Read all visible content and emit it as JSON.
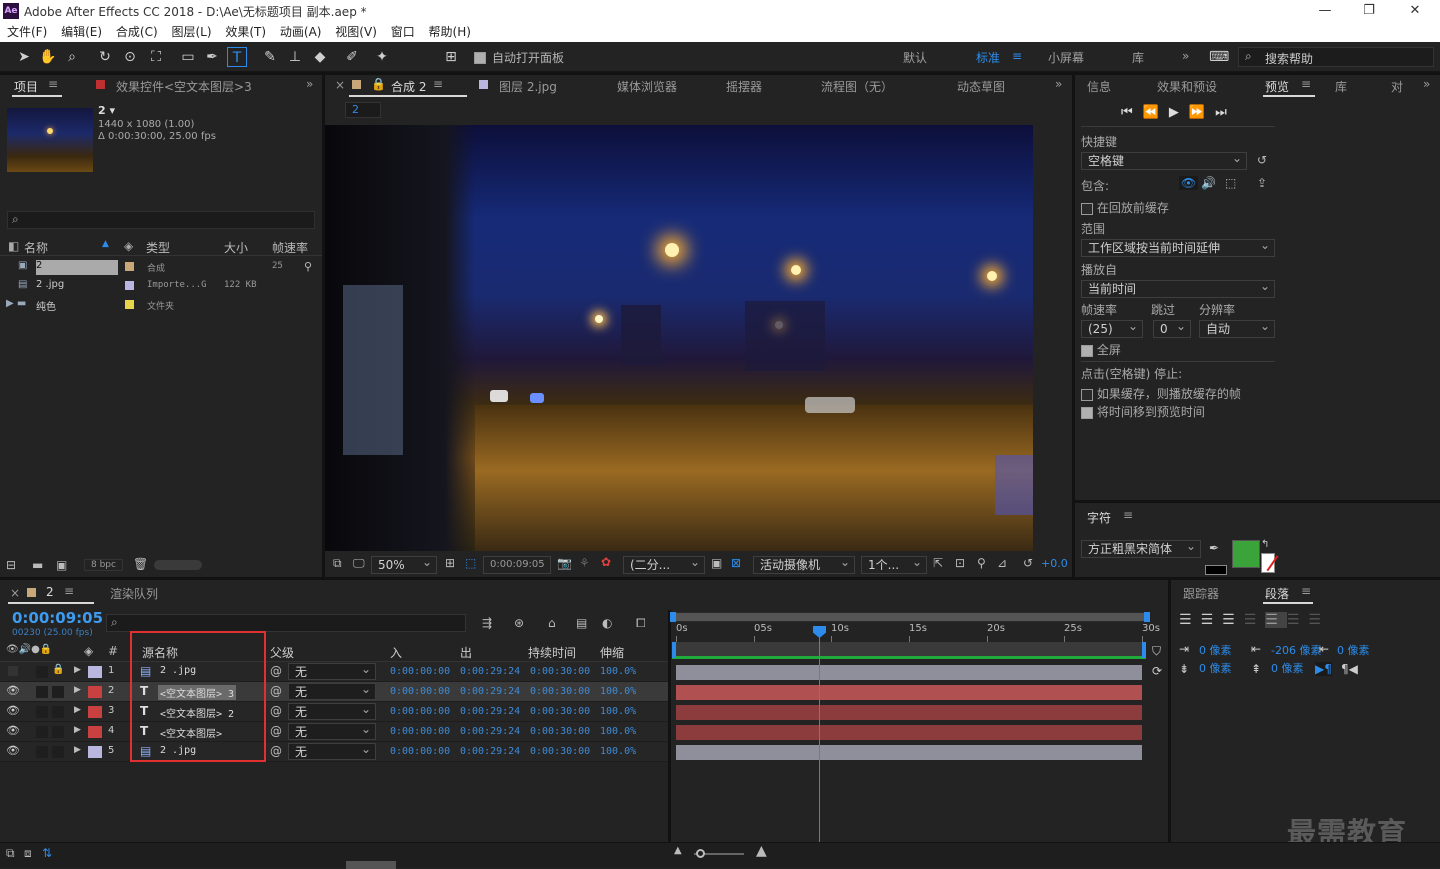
{
  "app": {
    "icon_text": "Ae",
    "title": "Adobe After Effects CC 2018 - D:\\Ae\\无标题项目 副本.aep *",
    "controls": [
      "—",
      "❐",
      "✕"
    ]
  },
  "menu": [
    "文件(F)",
    "编辑(E)",
    "合成(C)",
    "图层(L)",
    "效果(T)",
    "动画(A)",
    "视图(V)",
    "窗口",
    "帮助(H)"
  ],
  "toolbar": {
    "auto_open_label": "自动打开面板",
    "workspaces": [
      "默认",
      "标准",
      "小屏幕",
      "库"
    ],
    "active_workspace": "标准",
    "search_help": "搜索帮助"
  },
  "project": {
    "tab_project": "项目",
    "tab_effects": "效果控件<空文本图层>3",
    "comp_name": "2 ▾",
    "comp_dims": "1440 x 1080 (1.00)",
    "comp_dur": "Δ 0:00:30:00, 25.00 fps",
    "columns": [
      "名称",
      "类型",
      "大小",
      "帧速率"
    ],
    "items": [
      {
        "name": "2",
        "type": "合成",
        "size": "",
        "fps": "25",
        "color": "#c8a878"
      },
      {
        "name": "2 .jpg",
        "type": "Importe...G",
        "size": "122 KB",
        "fps": "",
        "color": "#b9b6e0"
      },
      {
        "name": "纯色",
        "type": "文件夹",
        "size": "",
        "fps": "",
        "color": "#e8d44a"
      }
    ],
    "bpc": "8 bpc"
  },
  "viewer": {
    "tab_comp": "合成 2",
    "tab_layer": "图层 2.jpg",
    "tab_media": "媒体浏览器",
    "tab_wiggler": "摇摆器",
    "tab_flow": "流程图（无）",
    "tab_motion": "动态草图",
    "breadcrumb": "2",
    "zoom": "50%",
    "timecode": "0:00:09:05",
    "resolution": "(二分...",
    "camera": "活动摄像机",
    "views": "1个...",
    "exposure": "+0.0"
  },
  "right": {
    "tabs": [
      "信息",
      "效果和预设",
      "预览",
      "库",
      "对"
    ],
    "active_tab": "预览",
    "shortcut_label": "快捷键",
    "shortcut_value": "空格键",
    "include_label": "包含:",
    "cache_before": "在回放前缓存",
    "range_label": "范围",
    "range_value": "工作区域按当前时间延伸",
    "play_from_label": "播放自",
    "play_from_value": "当前时间",
    "fps_label": "帧速率",
    "skip_label": "跳过",
    "res_label": "分辨率",
    "fps_value": "(25)",
    "skip_value": "0",
    "res_value": "自动",
    "fullscreen": "全屏",
    "stop_label": "点击(空格键) 停止:",
    "cache_option": "如果缓存，则播放缓存的帧",
    "move_time": "将时间移到预览时间",
    "char_tab": "字符",
    "font_value": "方正粗黑宋简体",
    "fill_color": "#3aa43a"
  },
  "paragraph": {
    "tabs": [
      "跟踪器",
      "段落"
    ],
    "active_tab": "段落",
    "indent_left": "0 像素",
    "indent_first": "-206 像素",
    "indent_right": "0 像素",
    "space_before": "0 像素",
    "space_after": "0 像素"
  },
  "timeline": {
    "tab_comp": "2",
    "tab_render": "渲染队列",
    "timecode": "0:00:09:05",
    "frame_info": "00230 (25.00 fps)",
    "col_source": "源名称",
    "col_parent": "父级",
    "col_in": "入",
    "col_out": "出",
    "col_duration": "持续时间",
    "col_stretch": "伸缩",
    "ruler": [
      "0s",
      "05s",
      "10s",
      "15s",
      "20s",
      "25s",
      "30s"
    ],
    "playhead_fraction": 0.3067,
    "layers": [
      {
        "num": "1",
        "type": "img",
        "name": "2 .jpg",
        "parent": "无",
        "in": "0:00:00:00",
        "out": "0:00:29:24",
        "dur": "0:00:30:00",
        "stretch": "100.0%",
        "color": "#b9b6e0",
        "bar": "#8f8f9c"
      },
      {
        "num": "2",
        "type": "T",
        "name": "<空文本图层> 3",
        "parent": "无",
        "in": "0:00:00:00",
        "out": "0:00:29:24",
        "dur": "0:00:30:00",
        "stretch": "100.0%",
        "color": "#c84040",
        "bar": "#a04848"
      },
      {
        "num": "3",
        "type": "T",
        "name": "<空文本图层> 2",
        "parent": "无",
        "in": "0:00:00:00",
        "out": "0:00:29:24",
        "dur": "0:00:30:00",
        "stretch": "100.0%",
        "color": "#c84040",
        "bar": "#8c3c3c"
      },
      {
        "num": "4",
        "type": "T",
        "name": "<空文本图层>",
        "parent": "无",
        "in": "0:00:00:00",
        "out": "0:00:29:24",
        "dur": "0:00:30:00",
        "stretch": "100.0%",
        "color": "#c84040",
        "bar": "#8c3c3c"
      },
      {
        "num": "5",
        "type": "img",
        "name": "2 .jpg",
        "parent": "无",
        "in": "0:00:00:00",
        "out": "0:00:29:24",
        "dur": "0:00:30:00",
        "stretch": "100.0%",
        "color": "#b9b6e0",
        "bar": "#8f8f9c"
      }
    ]
  },
  "watermark": "最需教育",
  "colors": {
    "accent": "#2d8ceb",
    "highlight_box": "#e03030",
    "work_area": "#1faa3b"
  }
}
